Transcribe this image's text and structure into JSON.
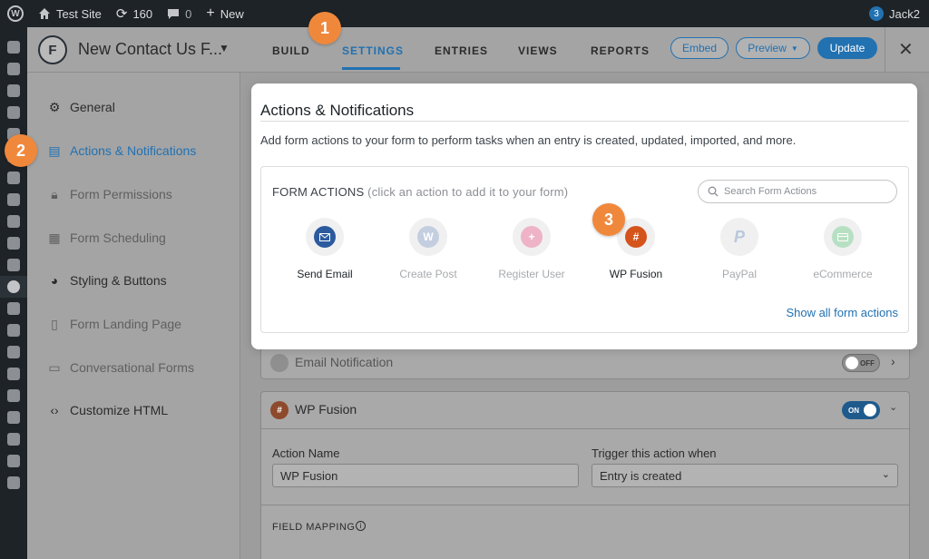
{
  "adminbar": {
    "site_name": "Test Site",
    "updates_count": "160",
    "comments_count": "0",
    "new_label": "New",
    "notif_count": "3",
    "user": "Jack2"
  },
  "header": {
    "form_title": "New Contact Us F...",
    "tabs": [
      {
        "label": "BUILD"
      },
      {
        "label": "SETTINGS"
      },
      {
        "label": "ENTRIES"
      },
      {
        "label": "VIEWS"
      },
      {
        "label": "REPORTS"
      }
    ],
    "embed_label": "Embed",
    "preview_label": "Preview",
    "update_label": "Update"
  },
  "sidebar": {
    "items": [
      {
        "label": "General"
      },
      {
        "label": "Actions & Notifications"
      },
      {
        "label": "Form Permissions"
      },
      {
        "label": "Form Scheduling"
      },
      {
        "label": "Styling & Buttons"
      },
      {
        "label": "Form Landing Page"
      },
      {
        "label": "Conversational Forms"
      },
      {
        "label": "Customize HTML"
      }
    ]
  },
  "popup": {
    "title": "Actions & Notifications",
    "description": "Add form actions to your form to perform tasks when an entry is created, updated, imported, and more.",
    "form_actions_label": "FORM ACTIONS",
    "form_actions_hint": "(click an action to add it to your form)",
    "search_placeholder": "Search Form Actions",
    "actions": [
      {
        "label": "Send Email"
      },
      {
        "label": "Create Post"
      },
      {
        "label": "Register User"
      },
      {
        "label": "WP Fusion"
      },
      {
        "label": "PayPal"
      },
      {
        "label": "eCommerce"
      }
    ],
    "show_all": "Show all form actions"
  },
  "main": {
    "email_notification": {
      "title": "Email Notification",
      "toggle": "OFF"
    },
    "wp_fusion": {
      "title": "WP Fusion",
      "toggle": "ON",
      "action_name_label": "Action Name",
      "action_name_value": "WP Fusion",
      "trigger_label": "Trigger this action when",
      "trigger_value": "Entry is created",
      "field_mapping_label": "FIELD MAPPING"
    }
  },
  "steps": [
    "1",
    "2",
    "3"
  ],
  "colors": {
    "accent": "#2271b1",
    "step_badge": "#f0883c",
    "adminbar_bg": "#1d2327",
    "wp_fusion_orange": "#d4541c"
  }
}
